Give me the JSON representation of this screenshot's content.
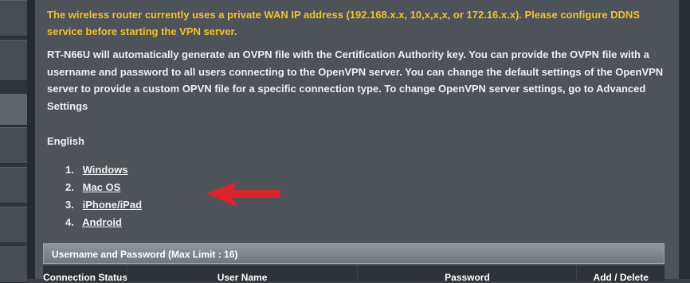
{
  "vpn": {
    "warning": "The wireless router currently uses a private WAN IP address (192.168.x.x, 10,x,x,x, or 172.16.x.x). Please configure DDNS service before starting the VPN server.",
    "description": "RT-N66U will automatically generate an OVPN file with the Certification Authority key. You can provide the OVPN file with a username and password to all users connecting to the OpenVPN server. You can change the default settings of the OpenVPN server to provide a custom OPVN file for a specific connection type. To change OpenVPN server settings, go to Advanced Settings",
    "language": "English",
    "links": [
      {
        "number": "1.",
        "label": "Windows"
      },
      {
        "number": "2.",
        "label": "Mac OS"
      },
      {
        "number": "3.",
        "label": "iPhone/iPad"
      },
      {
        "number": "4.",
        "label": "Android"
      }
    ],
    "annotation_arrow_icon": "red-arrow-icon",
    "arrow_color": "#d8242b"
  },
  "users_table": {
    "title": "Username and Password (Max Limit : 16)",
    "columns": [
      "Connection Status",
      "User Name",
      "Password",
      "Add / Delete"
    ]
  },
  "colors": {
    "warning": "#f3c12e",
    "panel": "#4d5358",
    "text": "#eef0f1"
  }
}
